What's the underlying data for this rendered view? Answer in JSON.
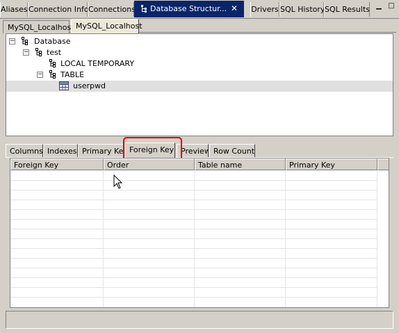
{
  "top_tabs": {
    "items": [
      "Aliases",
      "Connection Info",
      "Connections",
      "Database Structur...",
      "Drivers",
      "SQL History",
      "SQL Results"
    ],
    "active_index": 3
  },
  "connection_tabs": [
    "MySQL_Localhost",
    "MySQL_Localhost"
  ],
  "tree": {
    "database": "Database",
    "schema": "test",
    "local_temporary": "LOCAL TEMPORARY",
    "table_group": "TABLE",
    "table_item": "userpwd"
  },
  "detail_tabs": [
    "Columns",
    "Indexes",
    "Primary Key",
    "Foreign Key",
    "Preview",
    "Row Count"
  ],
  "detail_active": "Foreign Key",
  "table": {
    "columns": [
      "Foreign Key",
      "Order",
      "Table name",
      "Primary Key"
    ],
    "rows": []
  },
  "colors": {
    "active_tab_bg": "#0a246a",
    "highlight": "#e00000",
    "chrome": "#d4d0c8"
  }
}
